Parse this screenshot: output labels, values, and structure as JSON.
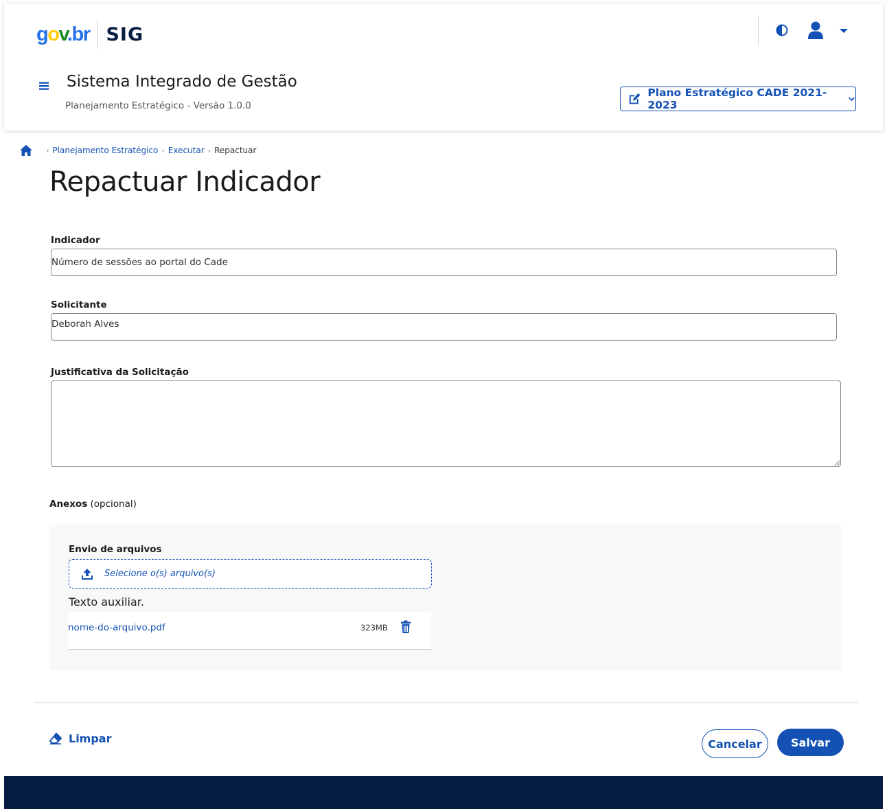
{
  "colors": {
    "primary": "#1351b4",
    "footer": "#071d41",
    "upload_panel_bg": "#f8f8f8"
  },
  "header": {
    "logo_gov_parts": [
      "g",
      "o",
      "v",
      ".br"
    ],
    "logo_sig": "SIG",
    "system_title": "Sistema Integrado de Gestão",
    "system_subtitle": "Planejamento Estratégico - Versão 1.0.0",
    "plan_selector": "Plano Estratégico CADE 2021-2023",
    "icons": [
      "contrast-icon",
      "user-icon",
      "caret-down-icon",
      "menu-icon",
      "edit-icon",
      "chevron-down-icon"
    ]
  },
  "breadcrumb": {
    "items": [
      "Planejamento Estratégico",
      "Executar"
    ],
    "current": "Repactuar"
  },
  "page_title": "Repactuar Indicador",
  "form": {
    "indicador_label": "Indicador",
    "indicador_value": "Número de sessões ao portal do Cade",
    "solicitante_label": "Solicitante",
    "solicitante_value": "Deborah Alves",
    "justificativa_label": "Justificativa da Solicitação",
    "justificativa_value": ""
  },
  "anexos": {
    "label": "Anexos",
    "optional": "(opcional)",
    "upload_title": "Envio de arquivos",
    "upload_button": "Selecione o(s) arquivo(s)",
    "helper_text": "Texto auxiliar.",
    "files": [
      {
        "name": "nome-do-arquivo.pdf",
        "size": "323MB"
      }
    ]
  },
  "actions": {
    "clear": "Limpar",
    "cancel": "Cancelar",
    "save": "Salvar"
  }
}
